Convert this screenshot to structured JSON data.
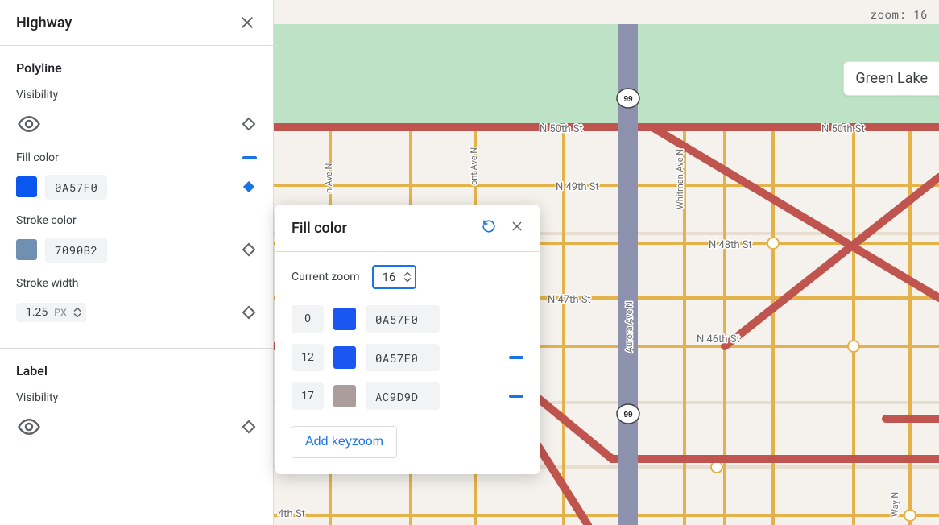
{
  "sidebar": {
    "title": "Highway",
    "polyline": {
      "title": "Polyline",
      "visibility_label": "Visibility",
      "fill_color": {
        "label": "Fill color",
        "hex": "0A57F0",
        "swatch_hex": "#0a57f0"
      },
      "stroke_color": {
        "label": "Stroke color",
        "hex": "7090B2",
        "swatch_hex": "#7090b2"
      },
      "stroke_width": {
        "label": "Stroke width",
        "value": "1.25",
        "unit": "PX"
      }
    },
    "label_section": {
      "title": "Label",
      "visibility_label": "Visibility"
    }
  },
  "zoom_readout": {
    "prefix": "zoom: ",
    "value": "16"
  },
  "map": {
    "chip": "Green Lake",
    "streets": {
      "n50th_1": "N 50th St",
      "n50th_2": "N 50th St",
      "n49th": "N 49th St",
      "n48th": "N 48th St",
      "n47th": "N 47th St",
      "n46th": "N 46th St",
      "n4xth": "4th St",
      "whitman": "Whitman Ave N",
      "aurora": "Aurora Ave N",
      "ont": "ont Ave N",
      "n_ave": "n Ave N",
      "wayn": "Way N"
    },
    "shield": "99"
  },
  "popover": {
    "title": "Fill color",
    "current_zoom_label": "Current zoom",
    "current_zoom_value": "16",
    "keyzooms": [
      {
        "zoom": "0",
        "swatch": "#1a57f0",
        "hex": "0A57F0",
        "has_marker": false
      },
      {
        "zoom": "12",
        "swatch": "#1a57f0",
        "hex": "0A57F0",
        "has_marker": true
      },
      {
        "zoom": "17",
        "swatch": "#ac9d9d",
        "hex": "AC9D9D",
        "has_marker": true
      }
    ],
    "add_label": "Add keyzoom"
  }
}
